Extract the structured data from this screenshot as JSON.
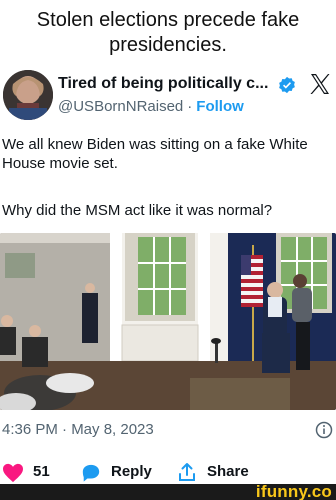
{
  "caption": "Stolen elections precede fake presidencies.",
  "tweet": {
    "author_name": "Tired of being politically c...",
    "handle": "@USBornNRaised",
    "separator": "·",
    "follow_label": "Follow",
    "text_line1": "We all knew Biden was sitting on a fake White House movie set.",
    "text_line2": "Why did the MSM act like it was normal?",
    "timestamp": "4:36 PM · May 8, 2023",
    "likes": "51",
    "reply_label": "Reply",
    "share_label": "Share"
  },
  "watermark": "ifunny.co",
  "colors": {
    "accent": "#1d9bf0",
    "heart": "#f91880",
    "reply": "#1d9bf0",
    "ifunny": "#f9c71a"
  }
}
